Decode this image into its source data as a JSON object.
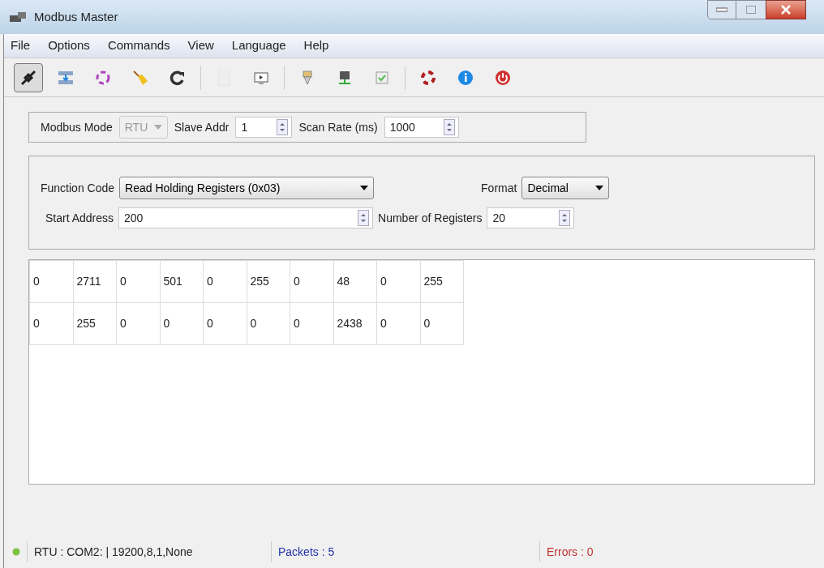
{
  "window": {
    "title": "Modbus Master"
  },
  "menu": [
    "File",
    "Options",
    "Commands",
    "View",
    "Language",
    "Help"
  ],
  "toolbar": [
    {
      "kind": "button",
      "pressed": true
    },
    {
      "kind": "button",
      "pressed": false
    },
    {
      "kind": "button",
      "pressed": false
    },
    {
      "kind": "button",
      "pressed": false
    },
    {
      "kind": "button",
      "pressed": false
    },
    {
      "kind": "separator"
    },
    {
      "kind": "button",
      "pressed": false,
      "disabled": true
    },
    {
      "kind": "button",
      "pressed": false,
      "disabled": false
    },
    {
      "kind": "separator"
    },
    {
      "kind": "button",
      "pressed": false,
      "disabled": false
    },
    {
      "kind": "button",
      "pressed": false,
      "disabled": false
    },
    {
      "kind": "button",
      "pressed": false,
      "disabled": false
    },
    {
      "kind": "separator"
    },
    {
      "kind": "button",
      "pressed": false,
      "disabled": false
    },
    {
      "kind": "button",
      "pressed": false,
      "disabled": false
    },
    {
      "kind": "button",
      "pressed": false,
      "disabled": false
    }
  ],
  "connection": {
    "mode_label": "Modbus Mode",
    "mode": {
      "value": "RTU",
      "disabled": true
    },
    "slave_label": "Slave Addr",
    "slave": "1",
    "scan_label": "Scan Rate (ms)",
    "scan": "1000"
  },
  "request": {
    "function_label": "Function Code",
    "function": "Read Holding Registers (0x03)",
    "format_label": "Format",
    "format": "Decimal",
    "start_label": "Start Address",
    "start": "200",
    "count_label": "Number of Registers",
    "count": "20"
  },
  "table": {
    "rows": [
      [
        "0",
        "2711",
        "0",
        "501",
        "0",
        "255",
        "0",
        "48",
        "0",
        "255"
      ],
      [
        "0",
        "255",
        "0",
        "0",
        "0",
        "0",
        "0",
        "2438",
        "0",
        "0"
      ]
    ]
  },
  "status_bar": {
    "connected": true,
    "color": "#7cc242",
    "port": "RTU : COM2: | 19200,8,1,None",
    "packets": "Packets : 5",
    "errors": "Errors : 0"
  }
}
